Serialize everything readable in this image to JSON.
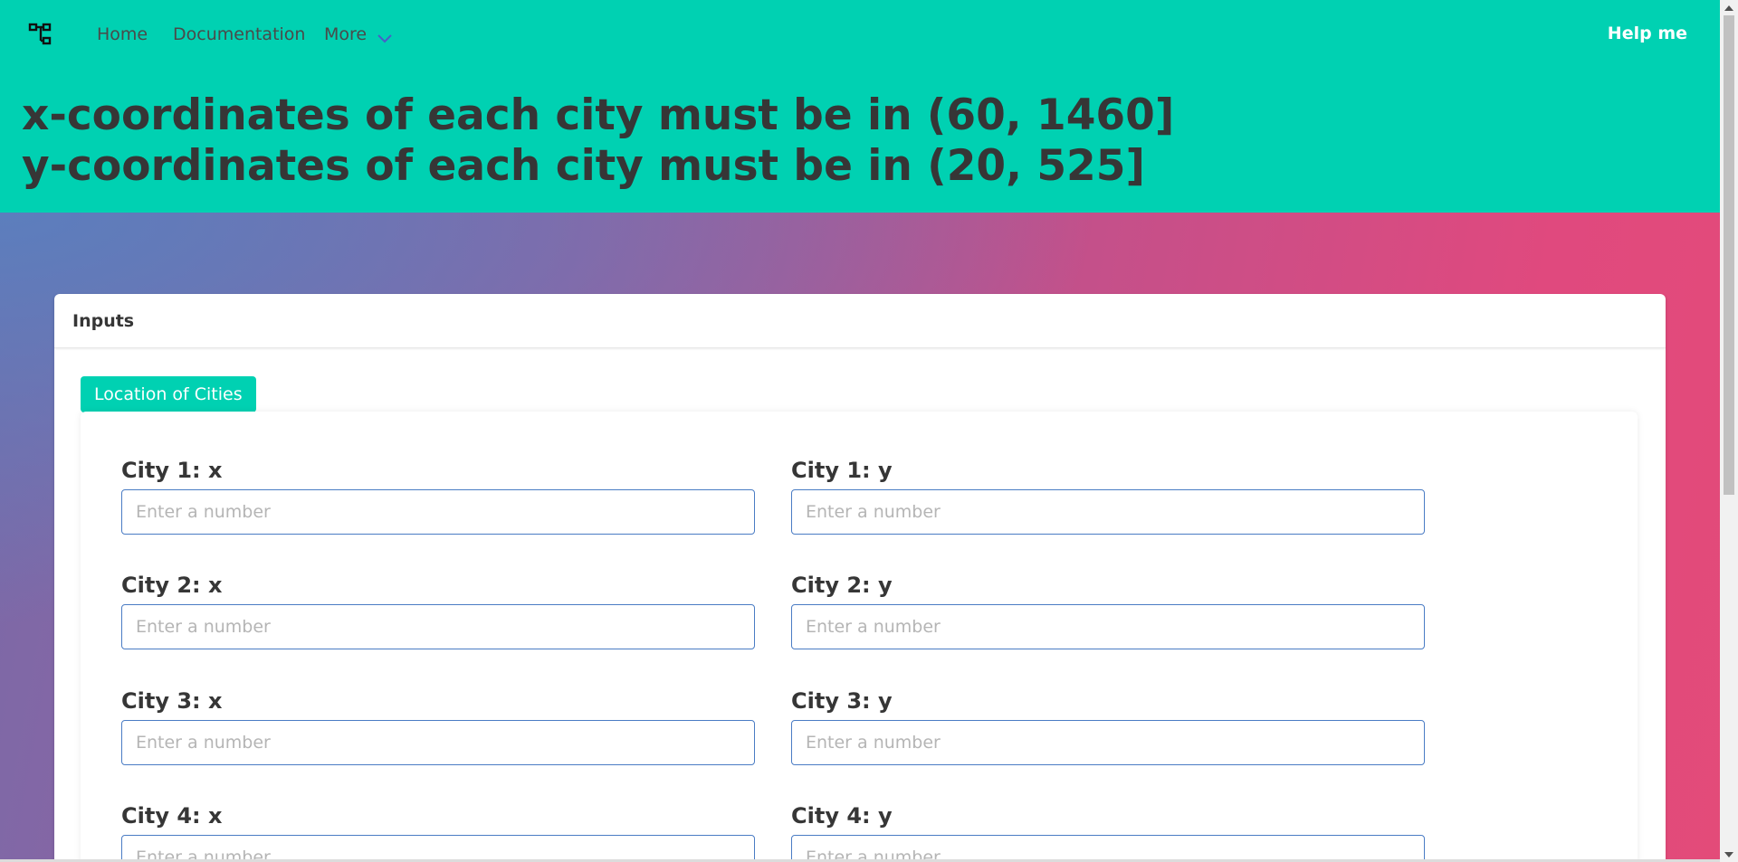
{
  "navbar": {
    "brand_icon": "sitemap-icon",
    "home_label": "Home",
    "docs_label": "Documentation",
    "more_label": "More",
    "help_label": "Help me"
  },
  "hero": {
    "line1": "x-coordinates of each city must be in (60, 1460]",
    "line2": "y-coordinates of each city must be in (20, 525]"
  },
  "card": {
    "title": "Inputs",
    "tag_label": "Location of Cities"
  },
  "fields": [
    {
      "label": "City 1: x",
      "placeholder": "Enter a number",
      "value": ""
    },
    {
      "label": "City 1: y",
      "placeholder": "Enter a number",
      "value": ""
    },
    {
      "label": "City 2: x",
      "placeholder": "Enter a number",
      "value": ""
    },
    {
      "label": "City 2: y",
      "placeholder": "Enter a number",
      "value": ""
    },
    {
      "label": "City 3: x",
      "placeholder": "Enter a number",
      "value": ""
    },
    {
      "label": "City 3: y",
      "placeholder": "Enter a number",
      "value": ""
    },
    {
      "label": "City 4: x",
      "placeholder": "Enter a number",
      "value": ""
    },
    {
      "label": "City 4: y",
      "placeholder": "Enter a number",
      "value": ""
    }
  ],
  "colors": {
    "primary": "#00d1b2",
    "input_border": "#4a7cc4",
    "chevron": "#485fc7"
  }
}
